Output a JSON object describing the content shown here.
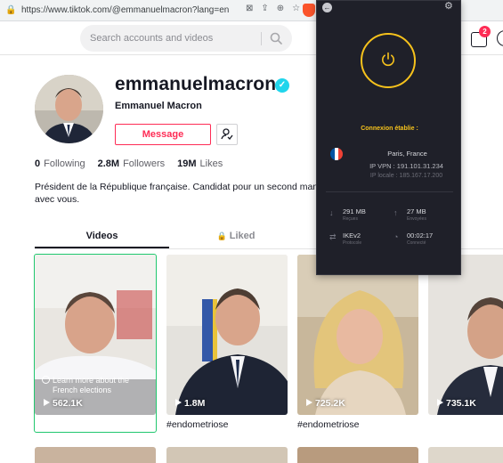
{
  "browser": {
    "url": "https://www.tiktok.com/@emmanuelmacron?lang=en"
  },
  "header": {
    "search_placeholder": "Search accounts and videos",
    "inbox_badge": "2"
  },
  "profile": {
    "username": "emmanuelmacron",
    "display_name": "Emmanuel Macron",
    "message_label": "Message",
    "following_count": "0",
    "following_label": "Following",
    "followers_count": "2.8M",
    "followers_label": "Followers",
    "likes_count": "19M",
    "likes_label": "Likes",
    "bio_line1": "Président de la République française. Candidat pour un second mandat",
    "bio_line2": "avec vous."
  },
  "tabs": {
    "videos": "Videos",
    "liked": "Liked"
  },
  "videos": [
    {
      "views": "562.1K",
      "caption": "",
      "overlay": "Learn more about the",
      "overlay2": "French elections"
    },
    {
      "views": "1.8M",
      "caption": "#endometriose"
    },
    {
      "views": "725.2K",
      "caption": "#endometriose"
    },
    {
      "views": "735.1K",
      "caption": ""
    }
  ],
  "vpn": {
    "status": "Connexion établie :",
    "location": "Paris, France",
    "ip_vpn": "IP VPN : 191.101.31.234",
    "ip_local": "IP locale : 185.167.17.200",
    "received": "291 MB",
    "received_label": "Reçues",
    "sent": "27 MB",
    "sent_label": "Envoyées",
    "protocol": "IKEv2",
    "protocol_label": "Protocole",
    "duration": "00:02:17",
    "duration_label": "Connecté",
    "accent_color": "#f6c21c"
  },
  "colors": {
    "brand": "#fe2c55",
    "verified": "#20d5ec",
    "text": "#161823"
  }
}
